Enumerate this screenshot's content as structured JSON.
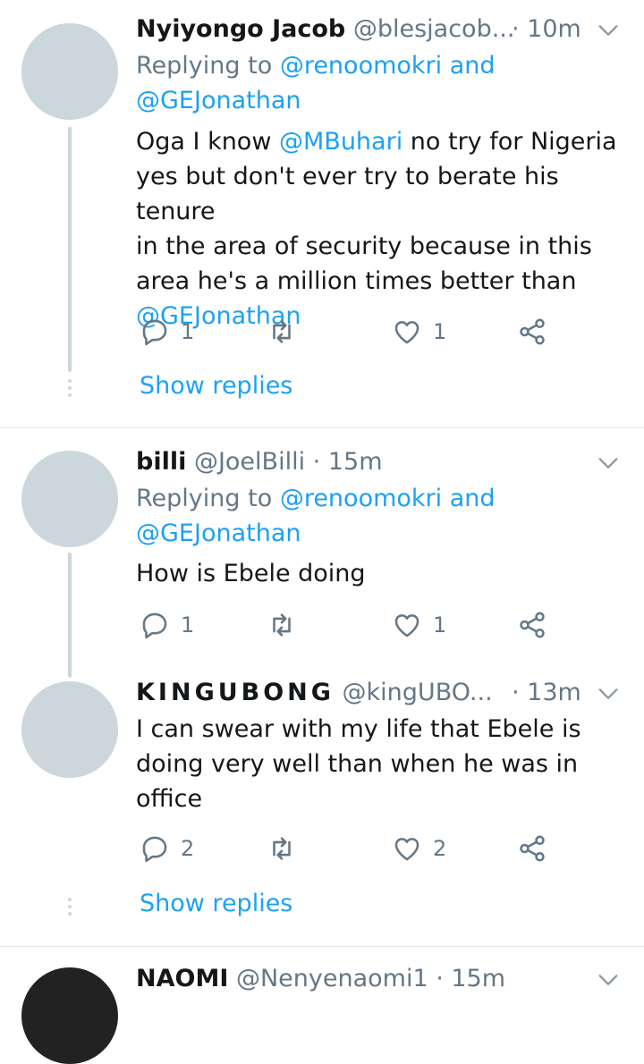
{
  "tweets": [
    {
      "name": "Nyiyongo Jacob",
      "handle": "@blesjacob...",
      "time": "· 10m",
      "replying_prefix": "Replying to ",
      "replying_to_1": "@renoomokri and",
      "replying_to_2": "@GEJonathan",
      "text_l1a": "Oga I know ",
      "text_l1_mention": "@MBuhari",
      "text_l1b": " no try for Nigeria",
      "text_l2": "yes but don't ever try to berate his tenure",
      "text_l3": "in the area of security because in this",
      "text_l4": "area he's a million times better than",
      "text_l5": "@GEJonathan",
      "reply_count": "1",
      "like_count": "1",
      "show_replies": "Show replies"
    },
    {
      "name": "billi",
      "handle": "@JoelBilli",
      "time": "· 15m",
      "replying_prefix": "Replying to ",
      "replying_to_1": "@renoomokri and",
      "replying_to_2": "@GEJonathan",
      "text": "How is Ebele doing",
      "reply_count": "1",
      "like_count": "1"
    },
    {
      "name": "KINGUBONG",
      "handle": "@kingUBO...",
      "time": "· 13m",
      "text_l1": "I can swear with my life that  Ebele is",
      "text_l2": "doing very well than when he was in",
      "text_l3": "office",
      "reply_count": "2",
      "like_count": "2",
      "show_replies": "Show replies"
    },
    {
      "name": "NAOMI",
      "handle": "@Nenyenaomi1",
      "time": "· 15m"
    }
  ],
  "colors": {
    "link": "#1da1f2",
    "secondary": "#657786",
    "avatar_placeholder": "#ccd6dd"
  }
}
